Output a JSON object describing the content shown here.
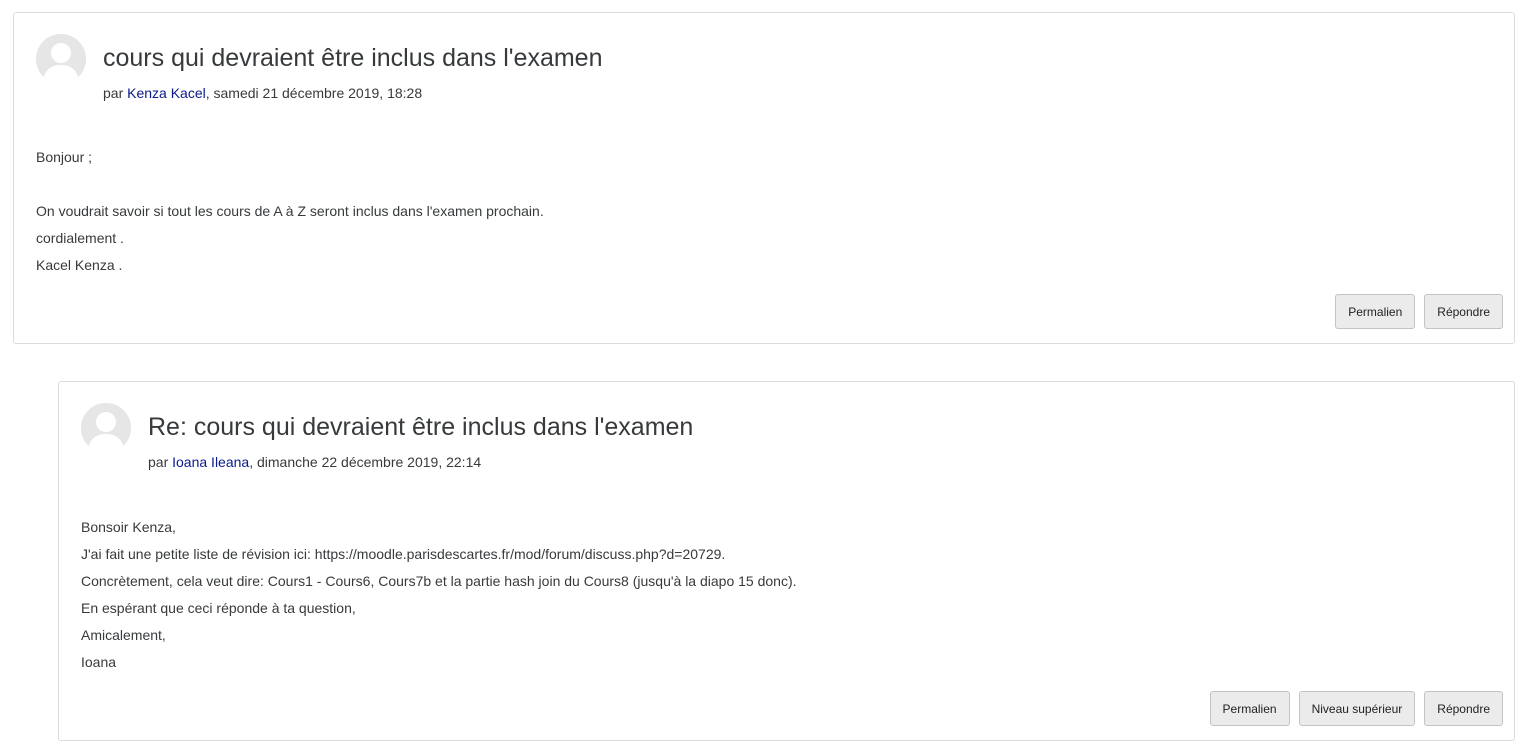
{
  "posts": [
    {
      "subject": "cours qui devraient être inclus dans l'examen",
      "by_prefix": "par ",
      "author": "Kenza Kacel",
      "date": ", samedi 21 décembre 2019, 18:28",
      "body": {
        "greeting": "Bonjour ;",
        "line1": "On voudrait savoir si tout les cours de A à Z seront inclus dans l'examen prochain.",
        "line2": "cordialement .",
        "line3": "Kacel Kenza ."
      },
      "actions": {
        "permalink": "Permalien",
        "reply": "Répondre"
      }
    },
    {
      "subject": "Re: cours qui devraient être inclus dans l'examen",
      "by_prefix": "par ",
      "author": "Ioana Ileana",
      "date": ", dimanche 22 décembre 2019, 22:14",
      "body": {
        "line1": "Bonsoir Kenza,",
        "line2": "J'ai fait une petite liste de révision ici: https://moodle.parisdescartes.fr/mod/forum/discuss.php?d=20729.",
        "line3": "Concrètement, cela veut dire: Cours1 - Cours6, Cours7b et la partie hash join du Cours8 (jusqu'à la diapo 15 donc).",
        "line4": "En espérant que ceci réponde à ta question,",
        "line5": "Amicalement,",
        "line6": "Ioana"
      },
      "actions": {
        "permalink": "Permalien",
        "parent": "Niveau supérieur",
        "reply": "Répondre"
      }
    }
  ],
  "icons": {
    "avatar": "user-avatar-icon"
  },
  "colors": {
    "link": "#0a1b8a",
    "text": "#373a3c",
    "border": "#dcdcdc",
    "button_bg": "#ebebeb"
  }
}
